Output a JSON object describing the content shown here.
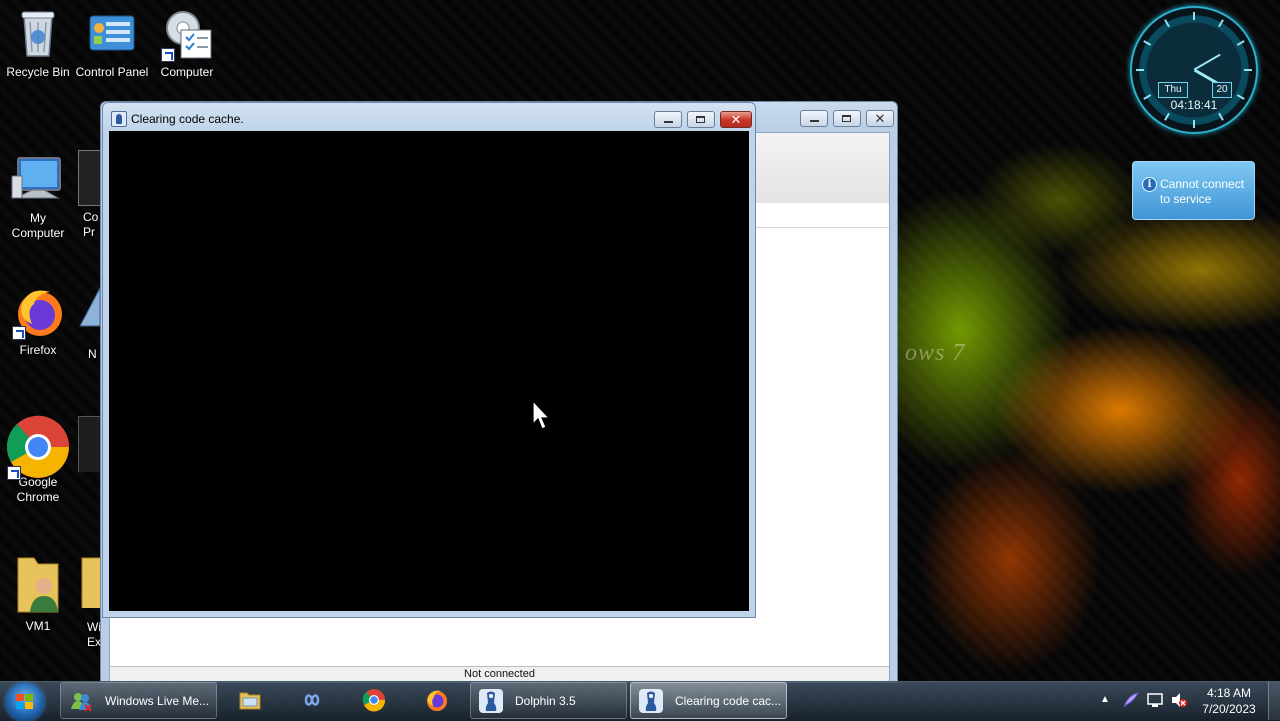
{
  "desktop": {
    "icons": [
      {
        "label": "Recycle Bin",
        "icon": "recycle-bin-icon"
      },
      {
        "label": "Control Panel",
        "icon": "control-panel-icon"
      },
      {
        "label": "Computer",
        "icon": "computer-gear-icon"
      },
      {
        "label": "My Computer",
        "icon": "monitor-icon"
      },
      {
        "label": "Firefox",
        "icon": "firefox-icon"
      },
      {
        "label": "Google Chrome",
        "icon": "chrome-icon"
      },
      {
        "label": "VM1",
        "icon": "user-folder-icon"
      }
    ],
    "partial_labels": [
      "Co",
      "Pr",
      "N",
      "Wi",
      "Ex"
    ],
    "watermark": "ows 7"
  },
  "front_window": {
    "title": "Clearing code cache.",
    "close_glyph": "✕"
  },
  "back_window": {
    "status_text": "Not connected"
  },
  "gadgets": {
    "clock_day": "Thu",
    "clock_date": "20",
    "clock_time": "04:18:41",
    "notification": "Cannot connect to service"
  },
  "taskbar": {
    "items": [
      {
        "label": "Windows Live Me...",
        "icon": "messenger-icon"
      },
      {
        "label": "",
        "icon": "explorer-icon"
      },
      {
        "label": "",
        "icon": "infinity-icon"
      },
      {
        "label": "",
        "icon": "chrome-icon"
      },
      {
        "label": "",
        "icon": "firefox-icon"
      },
      {
        "label": "Dolphin 3.5",
        "icon": "dolphin-icon"
      },
      {
        "label": "Clearing code cac...",
        "icon": "dolphin-icon"
      }
    ],
    "clock_time": "4:18 AM",
    "clock_date": "7/20/2023"
  },
  "colors": {
    "console_bg": "#000000",
    "window_frame": "#bfd3ea",
    "close_button": "#c8372c",
    "notification_bg": "#3f95d6"
  }
}
